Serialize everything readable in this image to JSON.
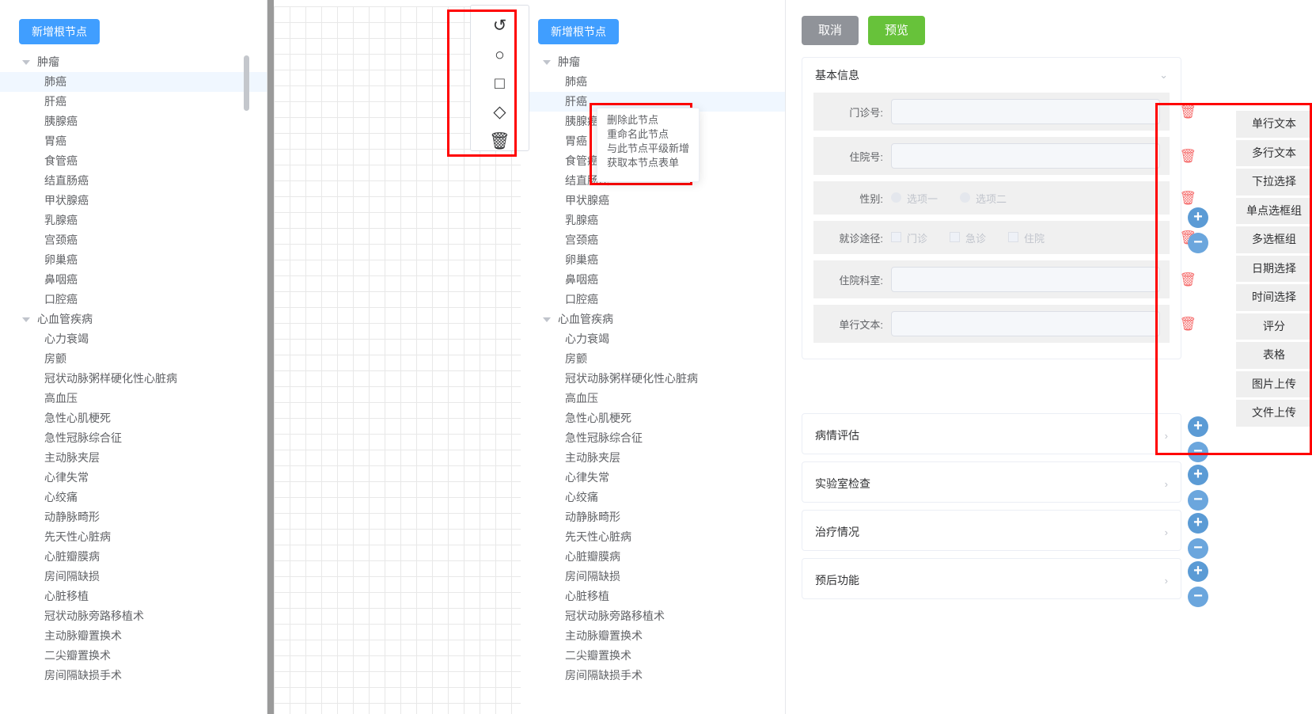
{
  "left_tree": {
    "add_root_button": "新增根节点",
    "nodes": [
      {
        "label": "肿瘤",
        "type": "root"
      },
      {
        "label": "肺癌",
        "type": "child",
        "selected": true
      },
      {
        "label": "肝癌",
        "type": "child"
      },
      {
        "label": "胰腺癌",
        "type": "child"
      },
      {
        "label": "胃癌",
        "type": "child"
      },
      {
        "label": "食管癌",
        "type": "child"
      },
      {
        "label": "结直肠癌",
        "type": "child"
      },
      {
        "label": "甲状腺癌",
        "type": "child"
      },
      {
        "label": "乳腺癌",
        "type": "child"
      },
      {
        "label": "宫颈癌",
        "type": "child"
      },
      {
        "label": "卵巢癌",
        "type": "child"
      },
      {
        "label": "鼻咽癌",
        "type": "child"
      },
      {
        "label": "口腔癌",
        "type": "child"
      },
      {
        "label": "心血管疾病",
        "type": "root"
      },
      {
        "label": "心力衰竭",
        "type": "child"
      },
      {
        "label": "房颤",
        "type": "child"
      },
      {
        "label": "冠状动脉粥样硬化性心脏病",
        "type": "child"
      },
      {
        "label": "高血压",
        "type": "child"
      },
      {
        "label": "急性心肌梗死",
        "type": "child"
      },
      {
        "label": "急性冠脉综合征",
        "type": "child"
      },
      {
        "label": "主动脉夹层",
        "type": "child"
      },
      {
        "label": "心律失常",
        "type": "child"
      },
      {
        "label": "心绞痛",
        "type": "child"
      },
      {
        "label": "动静脉畸形",
        "type": "child"
      },
      {
        "label": "先天性心脏病",
        "type": "child"
      },
      {
        "label": "心脏瓣膜病",
        "type": "child"
      },
      {
        "label": "房间隔缺损",
        "type": "child"
      },
      {
        "label": "心脏移植",
        "type": "child"
      },
      {
        "label": "冠状动脉旁路移植术",
        "type": "child"
      },
      {
        "label": "主动脉瓣置换术",
        "type": "child"
      },
      {
        "label": "二尖瓣置换术",
        "type": "child"
      },
      {
        "label": "房间隔缺损手术",
        "type": "child"
      }
    ]
  },
  "shape_toolbar": {
    "tools": [
      {
        "name": "undo-icon",
        "glyph": "↺"
      },
      {
        "name": "circle-shape-icon",
        "glyph": "○"
      },
      {
        "name": "square-shape-icon",
        "glyph": "□"
      },
      {
        "name": "diamond-shape-icon",
        "glyph": "◇"
      },
      {
        "name": "delete-icon",
        "glyph": "🗑"
      }
    ]
  },
  "mid_tree": {
    "add_root_button": "新增根节点",
    "nodes": [
      {
        "label": "肿瘤",
        "type": "root"
      },
      {
        "label": "肺癌",
        "type": "child"
      },
      {
        "label": "肝癌",
        "type": "child",
        "selected": true
      },
      {
        "label": "胰腺癌",
        "type": "child"
      },
      {
        "label": "胃癌",
        "type": "child"
      },
      {
        "label": "食管癌",
        "type": "child"
      },
      {
        "label": "结直肠癌",
        "type": "child"
      },
      {
        "label": "甲状腺癌",
        "type": "child"
      },
      {
        "label": "乳腺癌",
        "type": "child"
      },
      {
        "label": "宫颈癌",
        "type": "child"
      },
      {
        "label": "卵巢癌",
        "type": "child"
      },
      {
        "label": "鼻咽癌",
        "type": "child"
      },
      {
        "label": "口腔癌",
        "type": "child"
      },
      {
        "label": "心血管疾病",
        "type": "root"
      },
      {
        "label": "心力衰竭",
        "type": "child"
      },
      {
        "label": "房颤",
        "type": "child"
      },
      {
        "label": "冠状动脉粥样硬化性心脏病",
        "type": "child"
      },
      {
        "label": "高血压",
        "type": "child"
      },
      {
        "label": "急性心肌梗死",
        "type": "child"
      },
      {
        "label": "急性冠脉综合征",
        "type": "child"
      },
      {
        "label": "主动脉夹层",
        "type": "child"
      },
      {
        "label": "心律失常",
        "type": "child"
      },
      {
        "label": "心绞痛",
        "type": "child"
      },
      {
        "label": "动静脉畸形",
        "type": "child"
      },
      {
        "label": "先天性心脏病",
        "type": "child"
      },
      {
        "label": "心脏瓣膜病",
        "type": "child"
      },
      {
        "label": "房间隔缺损",
        "type": "child"
      },
      {
        "label": "心脏移植",
        "type": "child"
      },
      {
        "label": "冠状动脉旁路移植术",
        "type": "child"
      },
      {
        "label": "主动脉瓣置换术",
        "type": "child"
      },
      {
        "label": "二尖瓣置换术",
        "type": "child"
      },
      {
        "label": "房间隔缺损手术",
        "type": "child"
      }
    ],
    "context_menu": [
      "删除此节点",
      "重命名此节点",
      "与此节点平级新增",
      "获取本节点表单"
    ]
  },
  "form": {
    "cancel_button": "取消",
    "preview_button": "预览",
    "basic_section": {
      "title": "基本信息",
      "rows": [
        {
          "label": "门诊号:",
          "widget": "input"
        },
        {
          "label": "住院号:",
          "widget": "input"
        },
        {
          "label": "性别:",
          "widget": "radio",
          "options": [
            "选项一",
            "选项二"
          ]
        },
        {
          "label": "就诊途径:",
          "widget": "checkbox",
          "options": [
            "门诊",
            "急诊",
            "住院"
          ]
        },
        {
          "label": "住院科室:",
          "widget": "input"
        },
        {
          "label": "单行文本:",
          "widget": "input"
        }
      ]
    },
    "sections": [
      {
        "title": "病情评估"
      },
      {
        "title": "实验室检查"
      },
      {
        "title": "治疗情况"
      },
      {
        "title": "预后功能"
      }
    ],
    "add_symbol": "+",
    "remove_symbol": "−"
  },
  "palette": {
    "items": [
      "单行文本",
      "多行文本",
      "下拉选择",
      "单点选框组",
      "多选框组",
      "日期选择",
      "时间选择",
      "评分",
      "表格",
      "图片上传",
      "文件上传"
    ]
  },
  "colors": {
    "primary": "#409eff",
    "success": "#67c23a",
    "info": "#909399",
    "danger": "#f56c6c",
    "highlight_box": "#ff0000"
  }
}
